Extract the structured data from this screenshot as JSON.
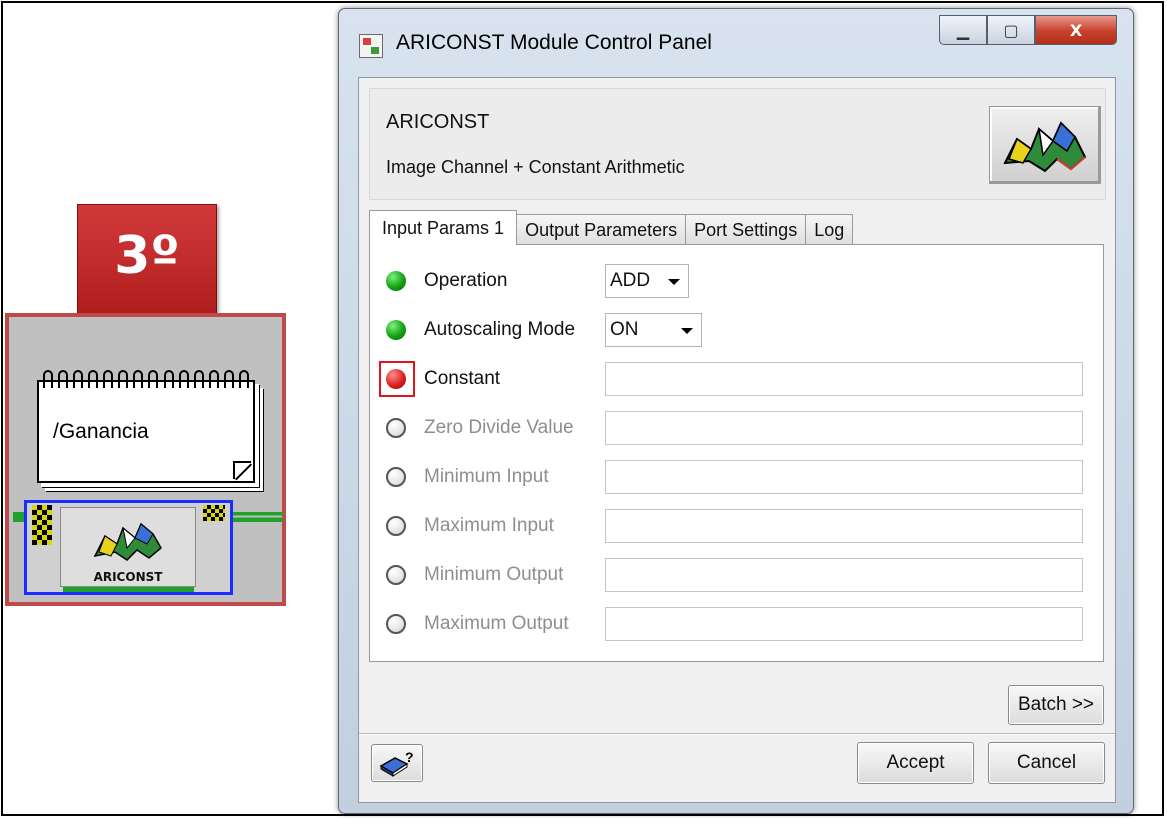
{
  "step_badge": "3º",
  "module": {
    "note_text": "/Ganancia",
    "node_label": "ARICONST"
  },
  "dialog": {
    "title": "ARICONST Module Control Panel",
    "window_buttons": {
      "minimize": "▁",
      "maximize": "▢",
      "close": "X"
    },
    "header": {
      "name": "ARICONST",
      "description": "Image Channel + Constant Arithmetic"
    },
    "tabs": [
      {
        "label": "Input Params 1",
        "active": true
      },
      {
        "label": "Output Parameters",
        "active": false
      },
      {
        "label": "Port Settings",
        "active": false
      },
      {
        "label": "Log",
        "active": false
      }
    ],
    "params": [
      {
        "label": "Operation",
        "status": "green",
        "value": "ADD",
        "type": "select"
      },
      {
        "label": "Autoscaling Mode",
        "status": "green",
        "value": "ON",
        "type": "select"
      },
      {
        "label": "Constant",
        "status": "red",
        "value": "",
        "type": "text",
        "highlighted": true
      },
      {
        "label": "Zero Divide Value",
        "status": "empty",
        "value": "",
        "type": "text",
        "disabled": true
      },
      {
        "label": "Minimum Input",
        "status": "empty",
        "value": "",
        "type": "text",
        "disabled": true
      },
      {
        "label": "Maximum Input",
        "status": "empty",
        "value": "",
        "type": "text",
        "disabled": true
      },
      {
        "label": "Minimum Output",
        "status": "empty",
        "value": "",
        "type": "text",
        "disabled": true
      },
      {
        "label": "Maximum Output",
        "status": "empty",
        "value": "",
        "type": "text",
        "disabled": true
      }
    ],
    "buttons": {
      "batch": "Batch >>",
      "accept": "Accept",
      "cancel": "Cancel",
      "help": "?"
    }
  },
  "colors": {
    "badge_red": "#c0292a",
    "led_green": "#13a113",
    "led_red": "#dd2020",
    "highlight_red": "#e0141b",
    "node_border_blue": "#1a2cff",
    "wire_green": "#1fa12b"
  }
}
